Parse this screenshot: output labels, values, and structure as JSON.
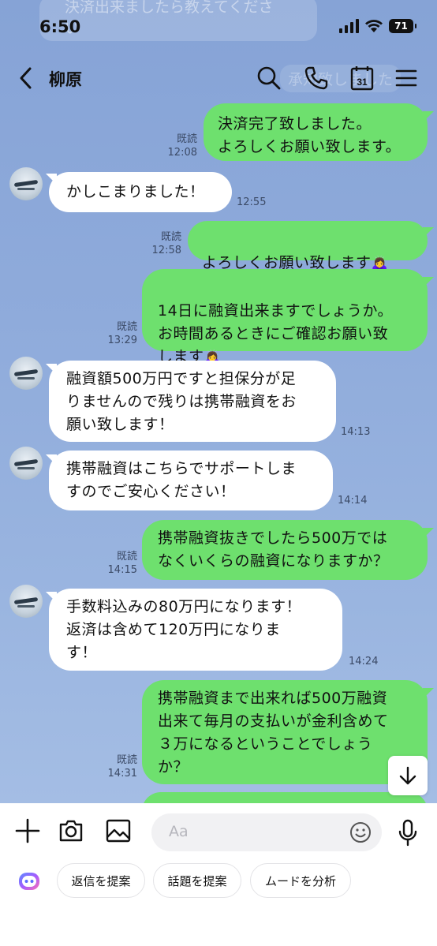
{
  "status_bar": {
    "time": "6:50",
    "battery": "71",
    "ghost_notification": "決済出来ましたら教えてくださ\nい"
  },
  "header": {
    "title": "柳原",
    "ghost_text": "承知致しました"
  },
  "messages": [
    {
      "dir": "out",
      "text": "決済完了致しました。\nよろしくお願い致します。",
      "read": "既読",
      "time": "12:08"
    },
    {
      "dir": "in",
      "text": "かしこまりました！",
      "time": "12:55"
    },
    {
      "dir": "out",
      "text": "よろしくお願い致します",
      "emoji": "🙇‍♀️",
      "read": "既読",
      "time": "12:58"
    },
    {
      "dir": "out",
      "text": "14日に融資出来ますでしょうか。\nお時間あるときにご確認お願い致\nします",
      "emoji": "🙇‍♀️",
      "read": "既読",
      "time": "13:29"
    },
    {
      "dir": "in",
      "text": "融資額500万円ですと担保分が足\nりませんので残りは携帯融資をお\n願い致します！",
      "time": "14:13"
    },
    {
      "dir": "in",
      "text": "携帯融資はこちらでサポートしま\nすのでご安心ください！",
      "time": "14:14"
    },
    {
      "dir": "out",
      "text": "携帯融資抜きでしたら500万では\nなくいくらの融資になりますか？",
      "read": "既読",
      "time": "14:15"
    },
    {
      "dir": "in",
      "text": "手数料込みの80万円になります！\n返済は含めて120万円になりま\nす！",
      "time": "14:24"
    },
    {
      "dir": "out",
      "text": "携帯融資まで出来れば500万融資\n出来て毎月の支払いが金利含めて\n３万になるということでしょう\nか？",
      "read": "既読",
      "time": "14:31"
    }
  ],
  "input": {
    "placeholder": "Aa"
  },
  "suggestions": [
    {
      "label": "返信を提案"
    },
    {
      "label": "話題を提案"
    },
    {
      "label": "ムードを分析"
    }
  ],
  "icons": {
    "back": "chevron-left-icon",
    "search": "search-icon",
    "call": "phone-icon",
    "calendar": "calendar-icon",
    "calendar_day": "31",
    "menu": "menu-icon",
    "scroll_down": "arrow-down-icon",
    "add": "plus-icon",
    "camera": "camera-icon",
    "image": "image-icon",
    "emoji": "smile-icon",
    "mic": "mic-icon",
    "ai": "ai-assistant-icon"
  },
  "colors": {
    "chat_bg": "#8aa7d8",
    "outgoing_bubble": "#6ee06e",
    "incoming_bubble": "#ffffff"
  }
}
